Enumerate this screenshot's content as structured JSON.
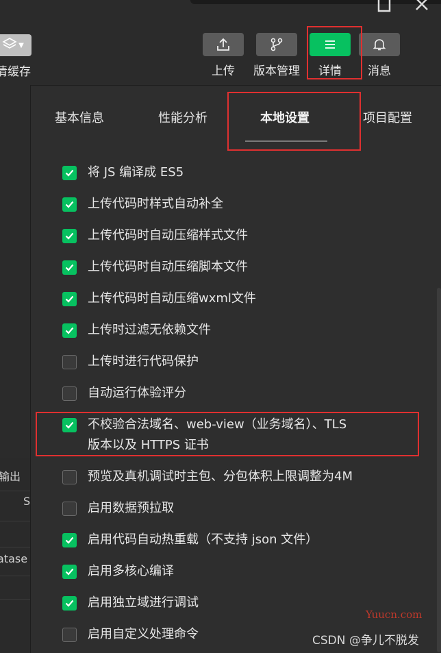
{
  "left": {
    "stack_label": "清缓存",
    "rows": [
      "输出",
      "S",
      "ataset"
    ]
  },
  "toolbar": {
    "upload": "上传",
    "version": "版本管理",
    "details": "详情",
    "messages": "消息"
  },
  "tabs": [
    "基本信息",
    "性能分析",
    "本地设置",
    "项目配置"
  ],
  "active_tab": "本地设置",
  "options": [
    {
      "label": "将 JS 编译成 ES5",
      "checked": true
    },
    {
      "label": "上传代码时样式自动补全",
      "checked": true
    },
    {
      "label": "上传代码时自动压缩样式文件",
      "checked": true
    },
    {
      "label": "上传代码时自动压缩脚本文件",
      "checked": true
    },
    {
      "label": "上传代码时自动压缩wxml文件",
      "checked": true
    },
    {
      "label": "上传时过滤无依赖文件",
      "checked": true
    },
    {
      "label": "上传时进行代码保护",
      "checked": false
    },
    {
      "label": "自动运行体验评分",
      "checked": false
    },
    {
      "label": "不校验合法域名、web-view（业务域名）、TLS",
      "label2": "版本以及 HTTPS 证书",
      "checked": true
    },
    {
      "label": "预览及真机调试时主包、分包体积上限调整为4M",
      "checked": false
    },
    {
      "label": "启用数据预拉取",
      "checked": false
    },
    {
      "label": "启用代码自动热重载（不支持 json 文件）",
      "checked": true
    },
    {
      "label": "启用多核心编译",
      "checked": true
    },
    {
      "label": "启用独立域进行调试",
      "checked": true
    },
    {
      "label": "启用自定义处理命令",
      "checked": false
    }
  ],
  "watermark": {
    "site": "Yuucn.com",
    "credit": "CSDN @争儿不脱发"
  },
  "colors": {
    "accent": "#07c160",
    "highlight": "#e03030"
  },
  "icons": [
    "stack-icon",
    "upload-icon",
    "branch-icon",
    "menu-icon",
    "bell-icon",
    "check-icon"
  ]
}
